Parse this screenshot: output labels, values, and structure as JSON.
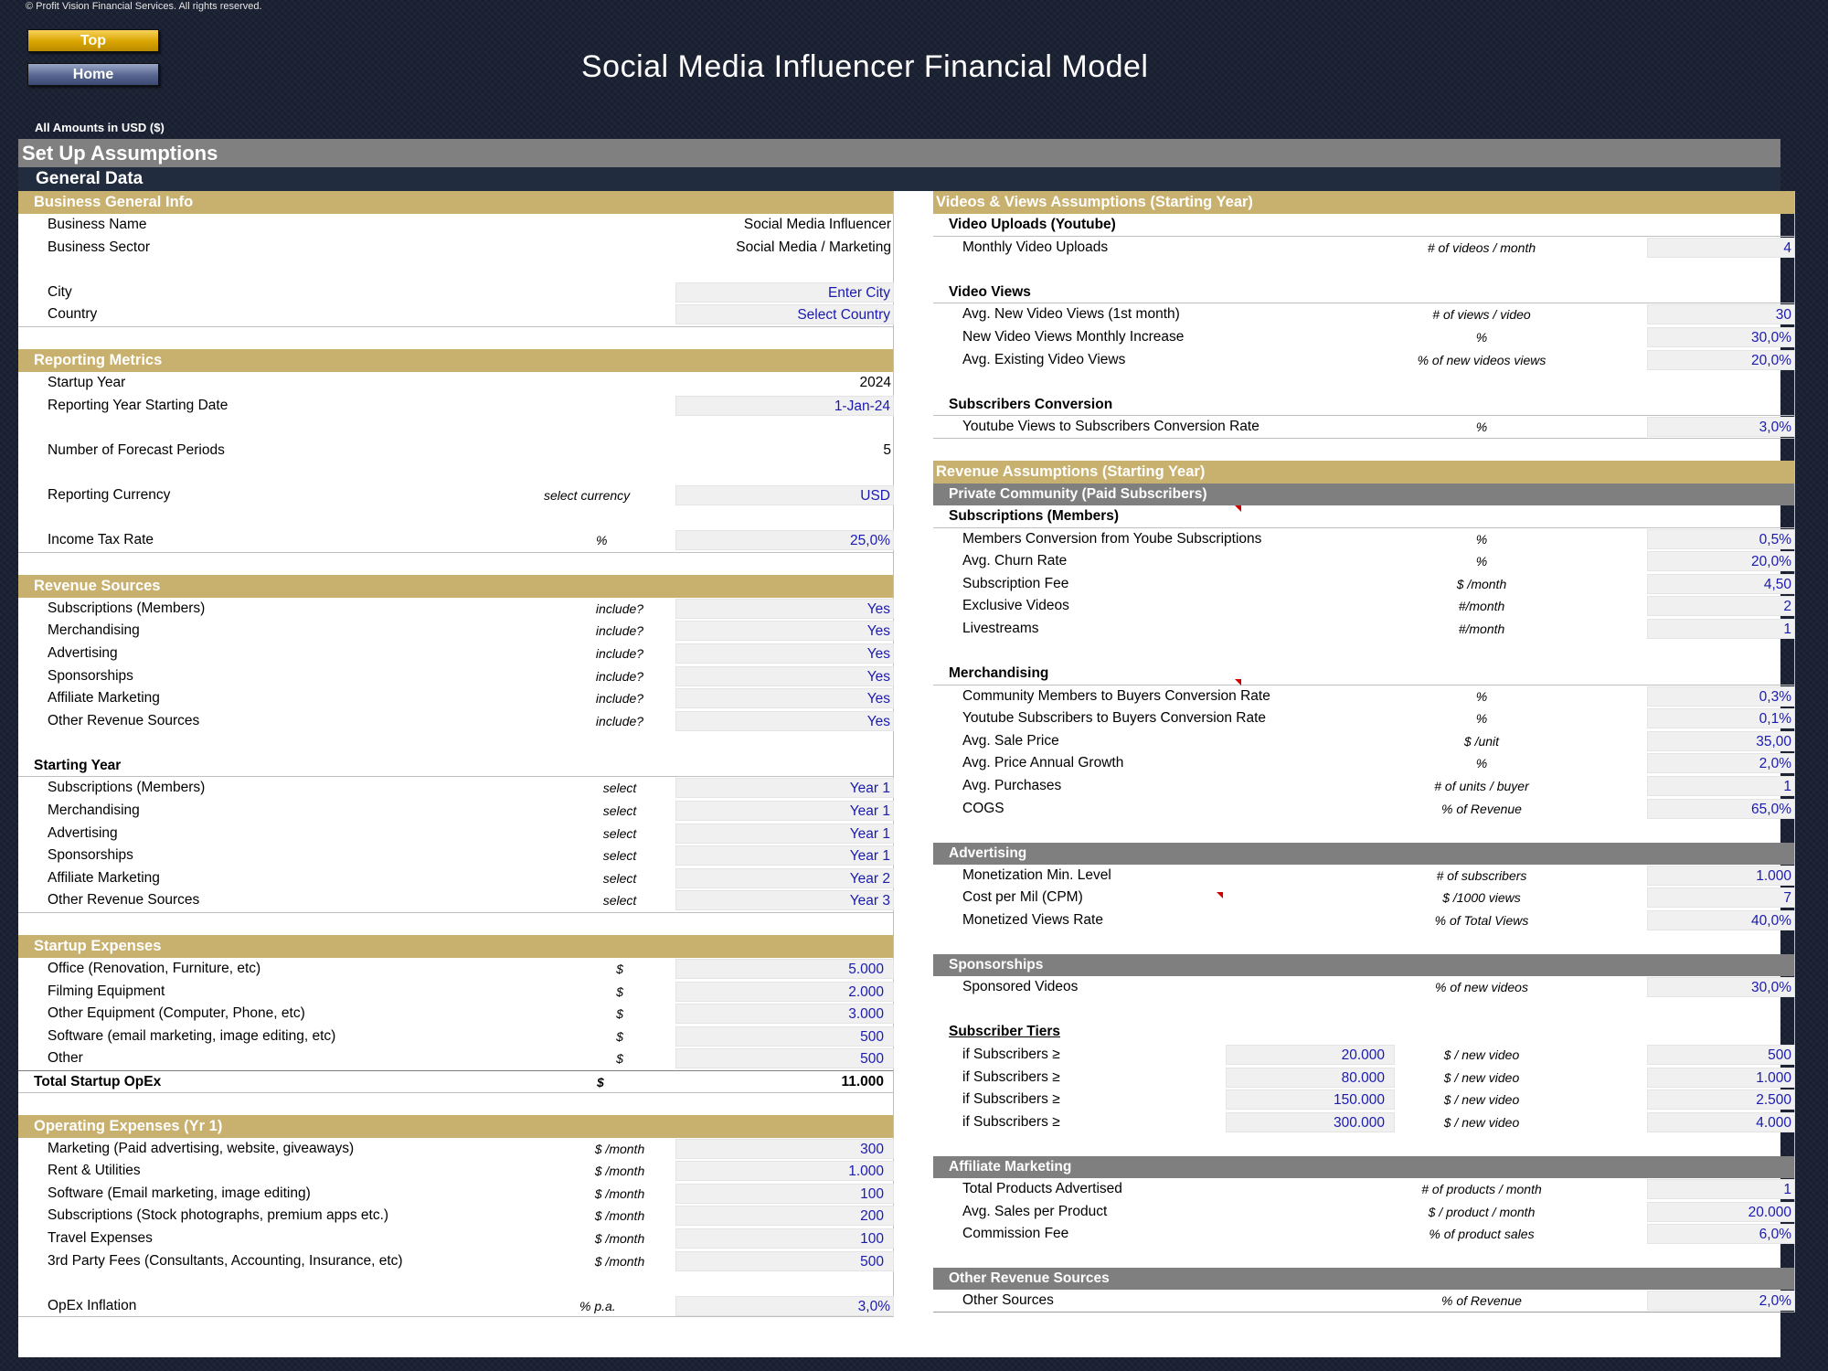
{
  "header": {
    "copyright": "© Profit Vision Financial Services. All rights reserved.",
    "top_button": "Top",
    "home_button": "Home",
    "title": "Social Media Influencer Financial Model",
    "amounts": "All Amounts in  USD ($)"
  },
  "setup_title": "Set Up Assumptions",
  "general_title": "General Data",
  "left": {
    "business": {
      "title": "Business General Info",
      "name_label": "Business Name",
      "name_value": "Social Media Influencer",
      "sector_label": "Business Sector",
      "sector_value": "Social Media / Marketing",
      "city_label": "City",
      "city_value": "Enter City",
      "country_label": "Country",
      "country_value": "Select Country"
    },
    "reporting": {
      "title": "Reporting Metrics",
      "startup_label": "Startup Year",
      "startup_value": "2024",
      "date_label": "Reporting Year Starting Date",
      "date_value": "1-Jan-24",
      "periods_label": "Number of Forecast Periods",
      "periods_value": "5",
      "currency_label": "Reporting Currency",
      "currency_unit": "select currency",
      "currency_value": "USD",
      "tax_label": "Income Tax Rate",
      "tax_unit": "%",
      "tax_value": "25,0%"
    },
    "revenue_sources": {
      "title": "Revenue Sources",
      "items": [
        {
          "label": "Subscriptions (Members)",
          "unit": "include?",
          "value": "Yes"
        },
        {
          "label": "Merchandising",
          "unit": "include?",
          "value": "Yes"
        },
        {
          "label": "Advertising",
          "unit": "include?",
          "value": "Yes"
        },
        {
          "label": "Sponsorships",
          "unit": "include?",
          "value": "Yes"
        },
        {
          "label": "Affiliate Marketing",
          "unit": "include?",
          "value": "Yes"
        },
        {
          "label": "Other Revenue Sources",
          "unit": "include?",
          "value": "Yes"
        }
      ],
      "starting_title": "Starting Year",
      "starting": [
        {
          "label": "Subscriptions (Members)",
          "unit": "select",
          "value": "Year 1"
        },
        {
          "label": "Merchandising",
          "unit": "select",
          "value": "Year 1"
        },
        {
          "label": "Advertising",
          "unit": "select",
          "value": "Year 1"
        },
        {
          "label": "Sponsorships",
          "unit": "select",
          "value": "Year 1"
        },
        {
          "label": "Affiliate Marketing",
          "unit": "select",
          "value": "Year 2"
        },
        {
          "label": "Other Revenue Sources",
          "unit": "select",
          "value": "Year 3"
        }
      ]
    },
    "startup_expenses": {
      "title": "Startup Expenses",
      "items": [
        {
          "label": "Office (Renovation, Furniture, etc)",
          "unit": "$",
          "value": "5.000"
        },
        {
          "label": "Filming Equipment",
          "unit": "$",
          "value": "2.000"
        },
        {
          "label": "Other Equipment (Computer, Phone, etc)",
          "unit": "$",
          "value": "3.000"
        },
        {
          "label": "Software (email marketing, image editing, etc)",
          "unit": "$",
          "value": "500"
        },
        {
          "label": "Other",
          "unit": "$",
          "value": "500"
        }
      ],
      "total_label": "Total Startup OpEx",
      "total_unit": "$",
      "total_value": "11.000"
    },
    "opex": {
      "title": "Operating Expenses (Yr 1)",
      "items": [
        {
          "label": "Marketing (Paid advertising, website, giveaways)",
          "unit": "$ /month",
          "value": "300"
        },
        {
          "label": "Rent & Utilities",
          "unit": "$ /month",
          "value": "1.000"
        },
        {
          "label": "Software (Email marketing, image editing)",
          "unit": "$ /month",
          "value": "100"
        },
        {
          "label": "Subscriptions (Stock photographs, premium apps etc.)",
          "unit": "$ /month",
          "value": "200"
        },
        {
          "label": "Travel Expenses",
          "unit": "$ /month",
          "value": "100"
        },
        {
          "label": "3rd Party Fees (Consultants, Accounting, Insurance, etc)",
          "unit": "$ /month",
          "value": "500"
        }
      ],
      "inflation_label": "OpEx Inflation",
      "inflation_unit": "% p.a.",
      "inflation_value": "3,0%"
    }
  },
  "right": {
    "videos": {
      "title": "Videos & Views Assumptions (Starting Year)",
      "uploads_title": "Video Uploads (Youtube)",
      "uploads": {
        "label": "Monthly Video Uploads",
        "unit": "# of videos / month",
        "value": "4"
      },
      "views_title": "Video Views",
      "views": [
        {
          "label": "Avg. New Video Views (1st month)",
          "unit": "# of views / video",
          "value": "30"
        },
        {
          "label": "New Video Views Monthly Increase",
          "unit": "%",
          "value": "30,0%"
        },
        {
          "label": "Avg. Existing Video Views",
          "unit": "% of new videos views",
          "value": "20,0%"
        }
      ],
      "subs_title": "Subscribers Conversion",
      "subs": {
        "label": "Youtube Views to Subscribers Conversion Rate",
        "unit": "%",
        "value": "3,0%"
      }
    },
    "revenue": {
      "title": "Revenue Assumptions (Starting Year)",
      "community_title": "Private Community (Paid Subscribers)",
      "subscriptions_title": "Subscriptions (Members)",
      "subscriptions": [
        {
          "label": "Members Conversion from Yoube Subscriptions",
          "unit": "%",
          "value": "0,5%"
        },
        {
          "label": "Avg. Churn Rate",
          "unit": "%",
          "value": "20,0%"
        },
        {
          "label": "Subscription Fee",
          "unit": "$ /month",
          "value": "4,50"
        },
        {
          "label": "Exclusive Videos",
          "unit": "#/month",
          "value": "2"
        },
        {
          "label": "Livestreams",
          "unit": "#/month",
          "value": "1"
        }
      ],
      "merch_title": "Merchandising",
      "merch": [
        {
          "label": "Community Members to Buyers Conversion Rate",
          "unit": "%",
          "value": "0,3%"
        },
        {
          "label": "Youtube Subscribers to Buyers Conversion Rate",
          "unit": "%",
          "value": "0,1%"
        },
        {
          "label": "Avg. Sale Price",
          "unit": "$ /unit",
          "value": "35,00"
        },
        {
          "label": "Avg. Price Annual Growth",
          "unit": "%",
          "value": "2,0%"
        },
        {
          "label": "Avg. Purchases",
          "unit": "# of units / buyer",
          "value": "1"
        },
        {
          "label": "COGS",
          "unit": "% of Revenue",
          "value": "65,0%"
        }
      ],
      "ads_title": "Advertising",
      "ads": [
        {
          "label": "Monetization Min. Level",
          "unit": "# of subscribers",
          "value": "1.000"
        },
        {
          "label": "Cost per Mil (CPM)",
          "unit": "$ /1000 views",
          "value": "7"
        },
        {
          "label": "Monetized Views Rate",
          "unit": "% of Total Views",
          "value": "40,0%"
        }
      ],
      "sponsor_title": "Sponsorships",
      "sponsor": {
        "label": "Sponsored Videos",
        "unit": "% of new videos",
        "value": "30,0%"
      },
      "tiers_title": "Subscriber Tiers",
      "tiers": [
        {
          "label": "if Subscribers ≥",
          "threshold": "20.000",
          "unit": "$ / new video",
          "value": "500"
        },
        {
          "label": "if Subscribers ≥",
          "threshold": "80.000",
          "unit": "$ / new video",
          "value": "1.000"
        },
        {
          "label": "if Subscribers ≥",
          "threshold": "150.000",
          "unit": "$ / new video",
          "value": "2.500"
        },
        {
          "label": "if Subscribers ≥",
          "threshold": "300.000",
          "unit": "$ / new video",
          "value": "4.000"
        }
      ],
      "affiliate_title": "Affiliate Marketing",
      "affiliate": [
        {
          "label": "Total Products Advertised",
          "unit": "# of products / month",
          "value": "1"
        },
        {
          "label": "Avg. Sales per Product",
          "unit": "$ / product / month",
          "value": "20.000"
        },
        {
          "label": "Commission Fee",
          "unit": "% of product sales",
          "value": "6,0%"
        }
      ],
      "other_title": "Other Revenue Sources",
      "other": {
        "label": "Other Sources",
        "unit": "% of Revenue",
        "value": "2,0%"
      }
    }
  },
  "colors": {
    "gold": "#c8b06e",
    "navy": "#222c3f",
    "gray": "#808080",
    "input_text": "#1a1ab0"
  }
}
